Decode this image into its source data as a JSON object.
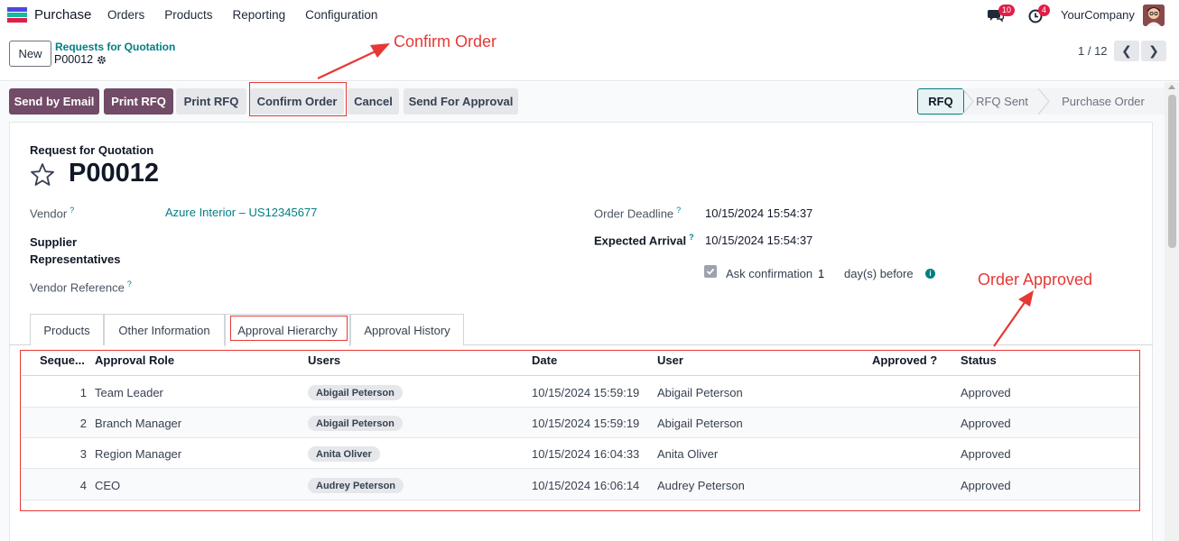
{
  "navbar": {
    "app_name": "Purchase",
    "menu": [
      "Orders",
      "Products",
      "Reporting",
      "Configuration"
    ],
    "chat_badge": "10",
    "activity_badge": "4",
    "company": "YourCompany"
  },
  "control_panel": {
    "new_label": "New",
    "breadcrumb_parent": "Requests for Quotation",
    "breadcrumb_current": "P00012",
    "pager": "1 / 12"
  },
  "actions": {
    "send_by_email": "Send by Email",
    "print_rfq_primary": "Print RFQ",
    "print_rfq": "Print RFQ",
    "confirm_order": "Confirm Order",
    "cancel": "Cancel",
    "send_for_approval": "Send For Approval"
  },
  "statusbar": [
    "RFQ",
    "RFQ Sent",
    "Purchase Order"
  ],
  "form": {
    "doc_type": "Request for Quotation",
    "name": "P00012",
    "vendor_label": "Vendor",
    "vendor_value": "Azure Interior – US12345677",
    "supplier_rep_label_1": "Supplier",
    "supplier_rep_label_2": "Representatives",
    "vendor_ref_label": "Vendor Reference",
    "order_deadline_label": "Order Deadline",
    "order_deadline_value": "10/15/2024 15:54:37",
    "expected_arrival_label": "Expected Arrival",
    "expected_arrival_value": "10/15/2024 15:54:37",
    "ask_confirmation_label": "Ask confirmation",
    "ask_confirmation_days": "1",
    "days_before": "day(s) before",
    "help_mark": "?"
  },
  "tabs": [
    "Products",
    "Other Information",
    "Approval Hierarchy",
    "Approval History"
  ],
  "table": {
    "headers": [
      "Seque...",
      "Approval Role",
      "Users",
      "Date",
      "User",
      "Approved ?",
      "Status"
    ],
    "rows": [
      {
        "seq": "1",
        "role": "Team Leader",
        "users": "Abigail Peterson",
        "date": "10/15/2024 15:59:19",
        "user": "Abigail Peterson",
        "status": "Approved"
      },
      {
        "seq": "2",
        "role": "Branch Manager",
        "users": "Abigail Peterson",
        "date": "10/15/2024 15:59:19",
        "user": "Abigail Peterson",
        "status": "Approved"
      },
      {
        "seq": "3",
        "role": "Region Manager",
        "users": "Anita Oliver",
        "date": "10/15/2024 16:04:33",
        "user": "Anita Oliver",
        "status": "Approved"
      },
      {
        "seq": "4",
        "role": "CEO",
        "users": "Audrey Peterson",
        "date": "10/15/2024 16:06:14",
        "user": "Audrey Peterson",
        "status": "Approved"
      }
    ]
  },
  "annotations": {
    "confirm_order": "Confirm Order",
    "order_approved": "Order Approved"
  },
  "colors": {
    "primary": "#714b67",
    "link": "#017e84",
    "annotation": "#e53935",
    "badge": "#e11d48"
  }
}
